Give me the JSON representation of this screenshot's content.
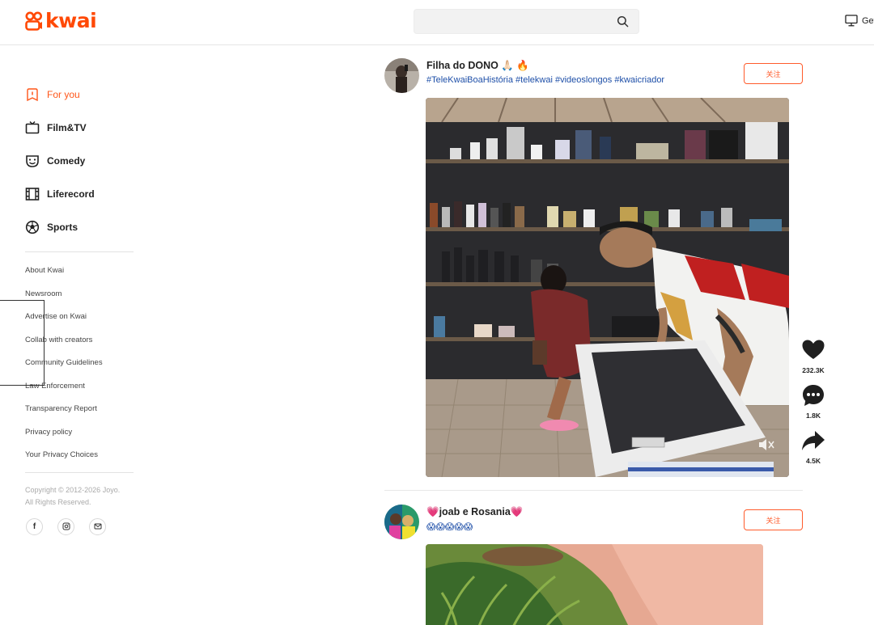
{
  "brand": {
    "name": "kwai",
    "color": "#ff4906"
  },
  "header": {
    "search_placeholder": "",
    "search_value": "",
    "get_app_label": "Get"
  },
  "sidebar": {
    "nav": [
      {
        "label": "For you",
        "icon": "for-you-icon",
        "active": true
      },
      {
        "label": "Film&TV",
        "icon": "tv-icon",
        "active": false
      },
      {
        "label": "Comedy",
        "icon": "comedy-mask-icon",
        "active": false
      },
      {
        "label": "Liferecord",
        "icon": "film-strip-icon",
        "active": false
      },
      {
        "label": "Sports",
        "icon": "soccer-ball-icon",
        "active": false
      }
    ],
    "links": [
      "About Kwai",
      "Newsroom",
      "Advertise on Kwai",
      "Collab with creators",
      "Community Guidelines",
      "Law Enforcement",
      "Transparency Report",
      "Privacy policy",
      "Your Privacy Choices"
    ],
    "copyright_line1": "Copyright © 2012-2026 Joyo.",
    "copyright_line2": "All Rights Reserved.",
    "socials": [
      {
        "name": "facebook-icon",
        "glyph": "f"
      },
      {
        "name": "instagram-icon",
        "glyph": ""
      },
      {
        "name": "email-icon",
        "glyph": ""
      }
    ]
  },
  "posts": [
    {
      "author": "Filha do DONO 🙏🏻 🔥",
      "description": "#TeleKwaiBoaHistória #telekwai #videoslongos #kwaicriador",
      "follow_label": "关注",
      "likes": "232.3K",
      "comments": "1.8K",
      "shares": "4.5K"
    },
    {
      "author": "💗joab e Rosania💗",
      "description": "😱😱😱😱😱",
      "follow_label": "关注"
    }
  ],
  "colors": {
    "accent": "#ff5619",
    "hashtag": "#1e4fa8"
  }
}
